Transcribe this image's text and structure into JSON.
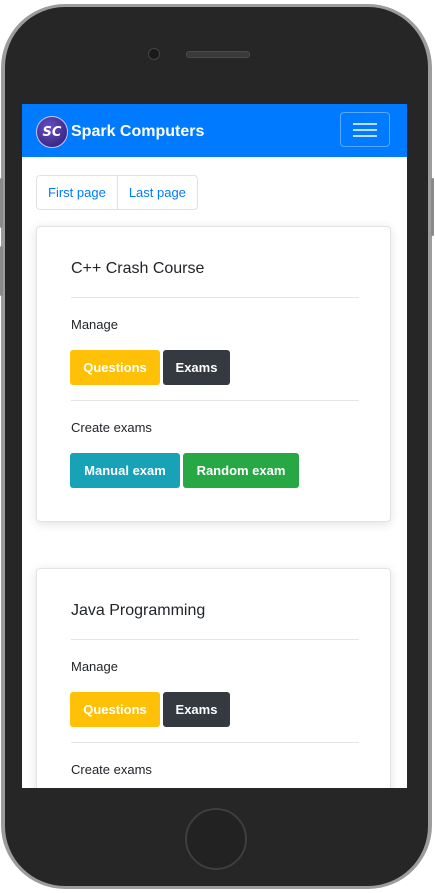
{
  "brand": {
    "logo_text": "SC",
    "name": "Spark Computers"
  },
  "pagination": {
    "first": "First page",
    "last": "Last page"
  },
  "courses": [
    {
      "title": "C++ Crash Course",
      "manage_label": "Manage",
      "questions_label": "Questions",
      "exams_label": "Exams",
      "create_label": "Create exams",
      "manual_label": "Manual exam",
      "random_label": "Random exam"
    },
    {
      "title": "Java Programming",
      "manage_label": "Manage",
      "questions_label": "Questions",
      "exams_label": "Exams",
      "create_label": "Create exams"
    }
  ],
  "colors": {
    "navbar": "#007bff",
    "warning": "#ffc107",
    "dark": "#343a40",
    "info": "#17a2b8",
    "success": "#28a745"
  },
  "icons": [
    "hamburger-menu-icon",
    "brand-logo"
  ]
}
